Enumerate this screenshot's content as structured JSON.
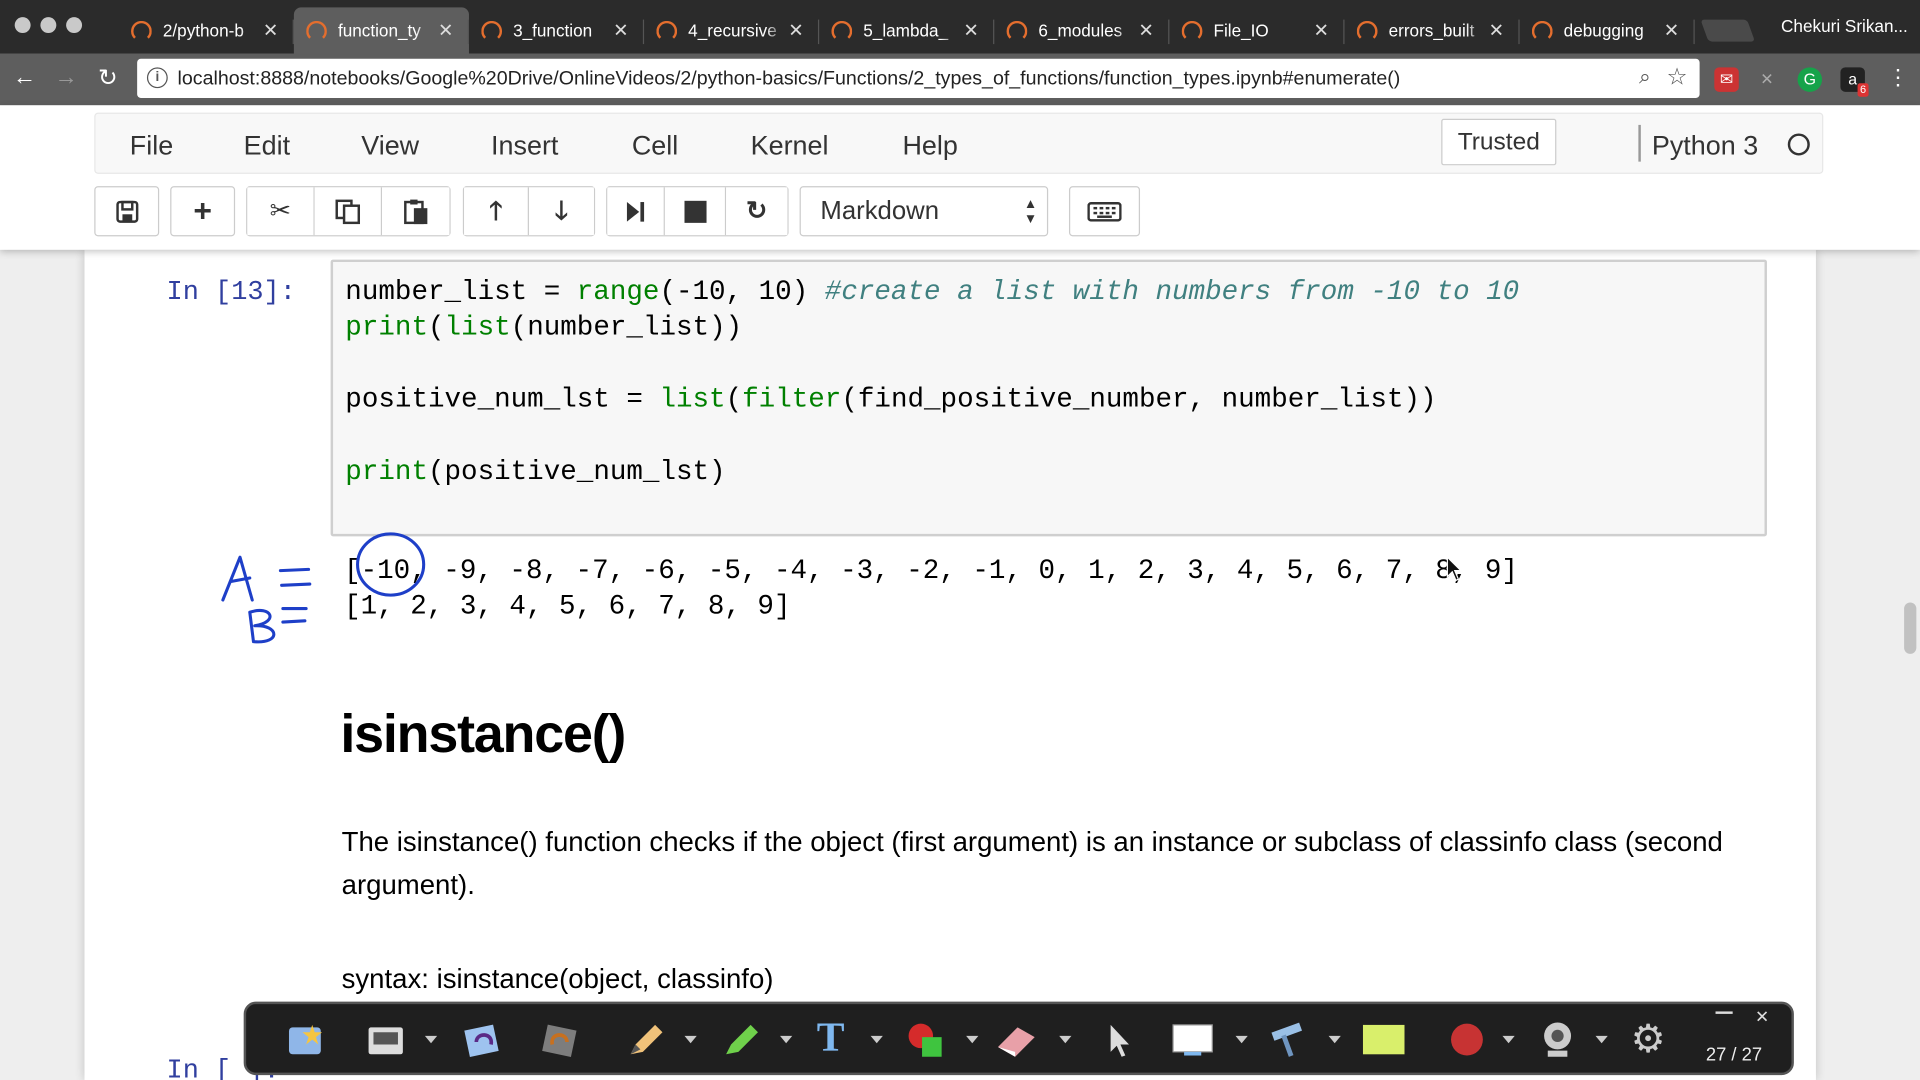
{
  "browser": {
    "tabs": [
      {
        "label": "2/python-b"
      },
      {
        "label": "function_ty",
        "active": true
      },
      {
        "label": "3_function"
      },
      {
        "label": "4_recursive"
      },
      {
        "label": "5_lambda_"
      },
      {
        "label": "6_modules"
      },
      {
        "label": "File_IO"
      },
      {
        "label": "errors_built"
      },
      {
        "label": "debugging"
      }
    ],
    "profile": "Chekuri Srikan...",
    "url": "localhost:8888/notebooks/Google%20Drive/OnlineVideos/2/python-basics/Functions/2_types_of_functions/function_types.ipynb#enumerate()",
    "ext_badge": "6"
  },
  "jupyter": {
    "menu": [
      "File",
      "Edit",
      "View",
      "Insert",
      "Cell",
      "Kernel",
      "Help"
    ],
    "trusted": "Trusted",
    "kernel": "Python 3",
    "cell_type": "Markdown"
  },
  "notebook": {
    "prompt": "In [13]:",
    "prompt_next": "In [ ]:",
    "code": {
      "l1_var": "number_list = ",
      "l1_fn": "range",
      "l1_args": "(-10, 10) ",
      "l1_comment": "#create a list with numbers from -10 to 10",
      "l2_fn1": "print",
      "l2_p": "(",
      "l2_fn2": "list",
      "l2_rest": "(number_list))",
      "l4_var": "positive_num_lst = ",
      "l4_fn1": "list",
      "l4_p": "(",
      "l4_fn2": "filter",
      "l4_rest": "(find_positive_number, number_list))",
      "l6_fn": "print",
      "l6_rest": "(positive_num_lst)"
    },
    "output": [
      "[-10, -9, -8, -7, -6, -5, -4, -3, -2, -1, 0, 1, 2, 3, 4, 5, 6, 7, 8, 9]",
      "[1, 2, 3, 4, 5, 6, 7, 8, 9]"
    ],
    "heading": "isinstance()",
    "description": "The isinstance() function checks if the object (first argument) is an instance or subclass of classinfo class (second argument).",
    "syntax": "syntax: isinstance(object, classinfo)"
  },
  "annotation_toolbar": {
    "page": "27 / 27"
  }
}
